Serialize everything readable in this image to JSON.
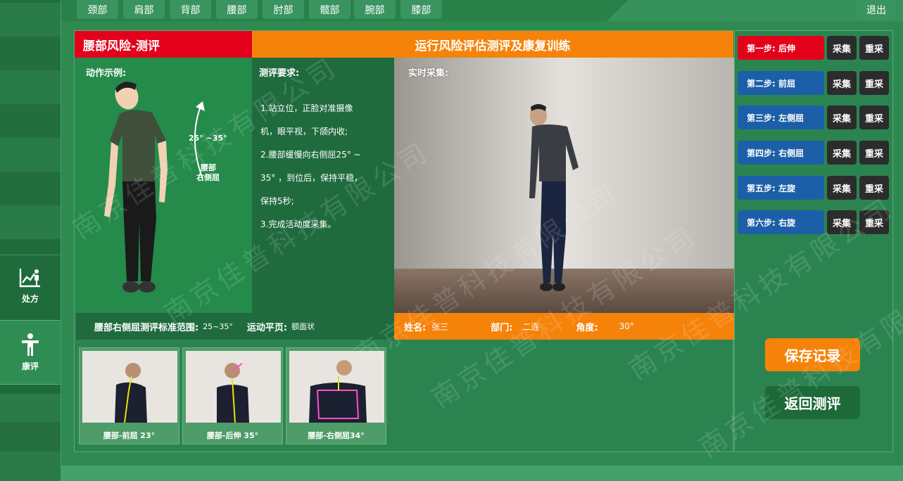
{
  "nav": {
    "tabs": [
      "颈部",
      "肩部",
      "背部",
      "腰部",
      "肘部",
      "髋部",
      "腕部",
      "膝部"
    ],
    "exit_label": "退出"
  },
  "sidebar": {
    "prescription_label": "处方",
    "assess_label": "康评"
  },
  "header": {
    "left_title": "腰部风险-测评",
    "main_title": "运行风险评估测评及康复训练"
  },
  "demo": {
    "label": "动作示例:",
    "angle_range": "25° ~35°",
    "angle_caption_1": "腰部",
    "angle_caption_2": "右侧屈"
  },
  "requirements": {
    "label": "测评要求:",
    "lines": [
      "1.站立位，正脸对准摄像",
      "机，眼平视，下颌内收;",
      "2.腰部缓慢向右侧屈25° ~",
      "35° ，到位后，保持平稳，",
      "保持5秒;",
      "3.完成活动度采集。"
    ]
  },
  "live": {
    "label": "实时采集:"
  },
  "standard": {
    "label": "腰部右侧屈测评标准范围:",
    "range": "25~35°",
    "plane_label": "运动平页:",
    "plane_value": "额面状"
  },
  "subject": {
    "name_label": "姓名:",
    "name": "张三",
    "dept_label": "部门:",
    "dept": "二连",
    "angle_label": "角度:",
    "angle": "30°"
  },
  "thumbnails": [
    {
      "caption": "腰部-前屈 23°"
    },
    {
      "caption": "腰部-后伸 35°"
    },
    {
      "caption": "腰部-右侧屈34°"
    }
  ],
  "steps": [
    {
      "label": "第一步: 后伸",
      "color": "#e3001b"
    },
    {
      "label": "第二步: 前屈",
      "color": "#1c5fa8"
    },
    {
      "label": "第三步: 左侧屈",
      "color": "#1c5fa8"
    },
    {
      "label": "第四步: 右侧屈",
      "color": "#1c5fa8"
    },
    {
      "label": "第五步: 左旋",
      "color": "#1c5fa8"
    },
    {
      "label": "第六步: 右旋",
      "color": "#1c5fa8"
    }
  ],
  "step_actions": {
    "collect": "采集",
    "redo": "重采"
  },
  "actions": {
    "save": "保存记录",
    "back": "返回测评"
  },
  "watermark": "南京佳普科技有限公司",
  "colors": {
    "red": "#e3001b",
    "orange": "#f5830a",
    "green": "#2b8450",
    "blue": "#1c5fa8"
  }
}
